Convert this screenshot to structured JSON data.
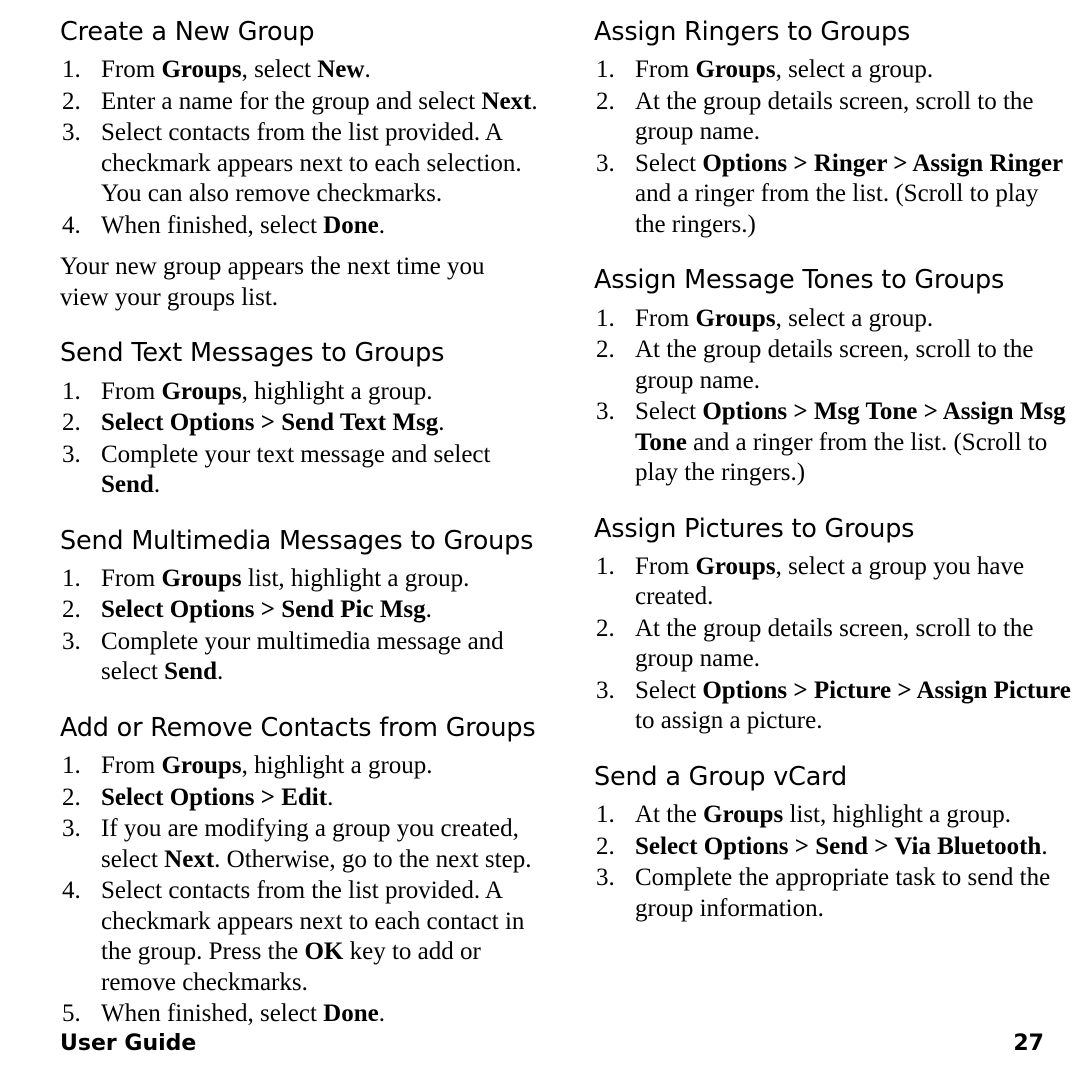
{
  "document": {
    "footer_label": "User Guide",
    "page_number": "27"
  },
  "left_column": {
    "sections": [
      {
        "title": "Create a New Group",
        "steps": [
          "From <b>Groups</b>, select <b>New</b>.",
          "Enter a name for the group and select <b>Next</b>.",
          "Select contacts from the list provided. A checkmark appears next to each selection. You can also remove checkmarks.",
          "When finished, select <b>Done</b>."
        ],
        "paragraph": "Your new group appears the next time you view your groups list."
      },
      {
        "title": "Send Text Messages to Groups",
        "steps": [
          "From <b>Groups</b>, highlight a group.",
          "<b>Select Options &gt; Send Text Msg</b>.",
          "Complete your text message and select <b>Send</b>."
        ]
      },
      {
        "title": "Send Multimedia Messages to Groups",
        "steps": [
          "From <b>Groups</b> list, highlight a group.",
          "<b>Select Options &gt; Send Pic Msg</b>.",
          "Complete your multimedia message and select <b>Send</b>."
        ]
      },
      {
        "title": "Add or Remove Contacts from Groups",
        "steps": [
          "From <b>Groups</b>, highlight a group.",
          "<b>Select Options &gt; Edit</b>.",
          "If you are modifying a group you created, select <b>Next</b>. Otherwise, go to the next step.",
          "Select contacts from the list provided. A checkmark appears next to each contact in the group. Press the <b>OK</b> key to add or remove checkmarks.",
          "When finished, select <b>Done</b>."
        ]
      }
    ]
  },
  "right_column": {
    "sections": [
      {
        "title": "Assign Ringers to Groups",
        "steps": [
          "From <b>Groups</b>, select a group.",
          "At the group details screen, scroll to the group name.",
          "Select <b>Options &gt; Ringer &gt; Assign Ringer</b> and a ringer from the list. (Scroll to play the ringers.)"
        ]
      },
      {
        "title": "Assign Message Tones to Groups",
        "steps": [
          "From <b>Groups</b>, select a group.",
          "At the group details screen, scroll to the group name.",
          "Select <b>Options &gt; Msg Tone &gt; Assign Msg Tone</b> and a ringer from the list. (Scroll to play the ringers.)"
        ]
      },
      {
        "title": "Assign Pictures to Groups",
        "steps": [
          "From <b>Groups</b>, select a group you have created.",
          "At the group details screen, scroll to the group name.",
          "Select <b>Options &gt; Picture &gt; Assign Picture</b> to assign a picture."
        ]
      },
      {
        "title": "Send a Group vCard",
        "steps": [
          "At the <b>Groups</b> list, highlight a group.",
          "<b>Select Options &gt; Send &gt; Via Bluetooth</b>.",
          "Complete the appropriate task to send the group information."
        ]
      }
    ]
  }
}
